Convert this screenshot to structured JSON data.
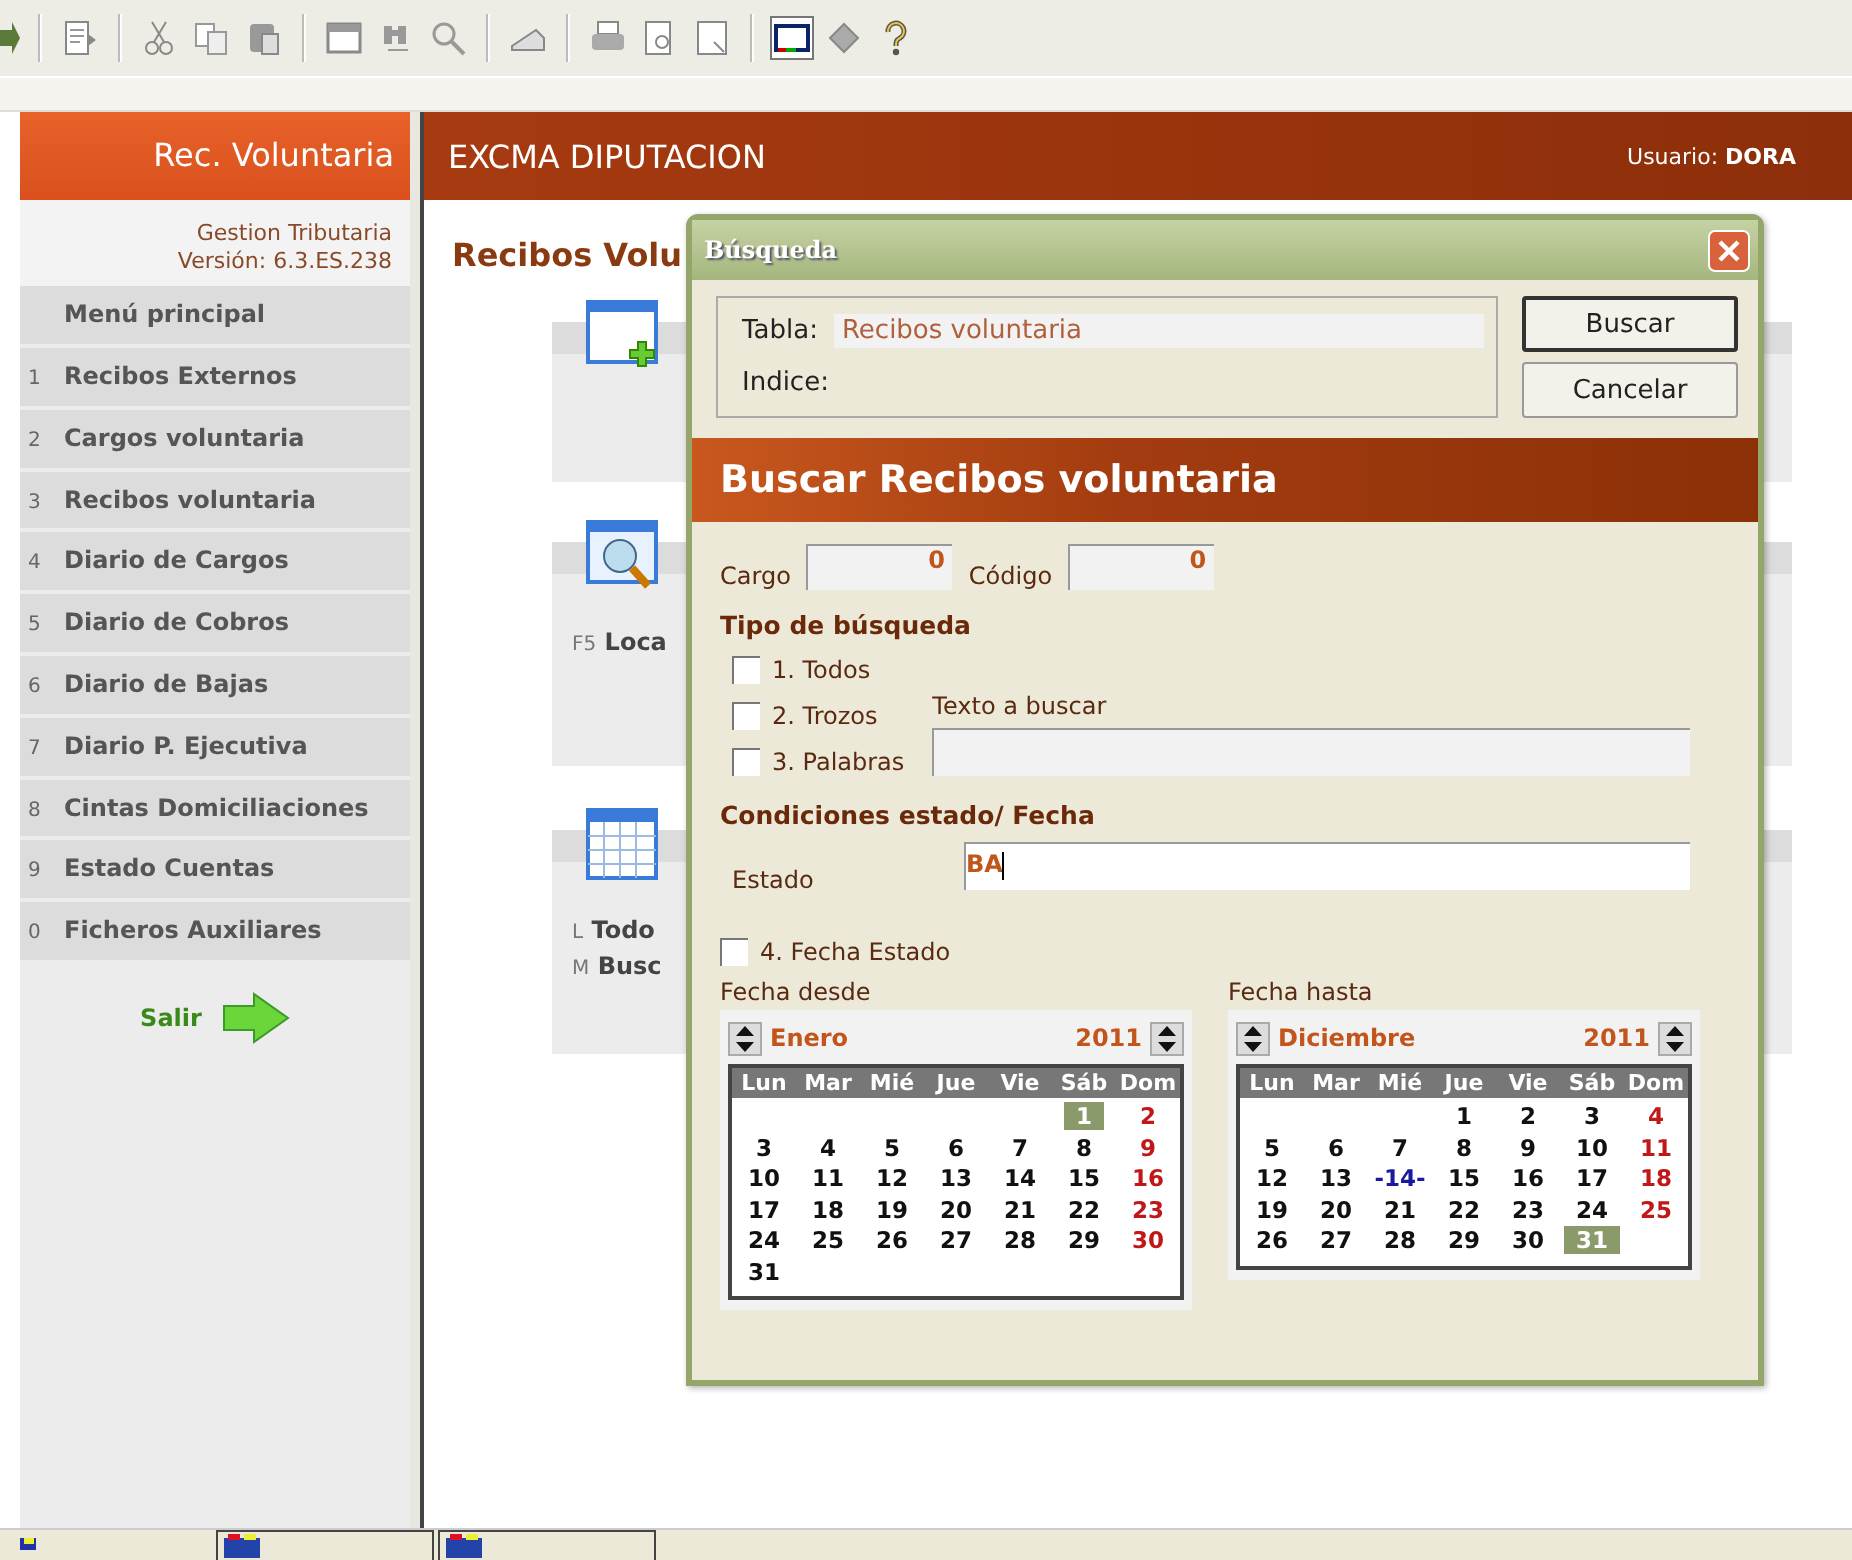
{
  "sidebar": {
    "title": "Rec. Voluntaria",
    "app_name": "Gestion Tributaria",
    "version": "Versión: 6.3.ES.238",
    "menu_heading": "Menú principal",
    "items": [
      {
        "key": "1",
        "label": "Recibos Externos"
      },
      {
        "key": "2",
        "label": "Cargos voluntaria"
      },
      {
        "key": "3",
        "label": "Recibos voluntaria"
      },
      {
        "key": "4",
        "label": "Diario de Cargos"
      },
      {
        "key": "5",
        "label": "Diario de Cobros"
      },
      {
        "key": "6",
        "label": "Diario de Bajas"
      },
      {
        "key": "7",
        "label": "Diario P. Ejecutiva"
      },
      {
        "key": "8",
        "label": "Cintas Domiciliaciones"
      },
      {
        "key": "9",
        "label": "Estado Cuentas"
      },
      {
        "key": "0",
        "label": "Ficheros Auxiliares"
      }
    ],
    "exit_label": "Salir"
  },
  "header": {
    "title": "EXCMA DIPUTACION",
    "user_label": "Usuario:",
    "user": "DORA"
  },
  "main": {
    "title": "Recibos Volu",
    "cards": [
      {
        "lines": [
          {
            "key": "F5",
            "label": "Loca"
          }
        ]
      },
      {
        "lines": [
          {
            "key": "L",
            "label": "Todo"
          },
          {
            "key": "M",
            "label": "Busc"
          }
        ]
      }
    ]
  },
  "dialog": {
    "title": "Búsqueda",
    "table_label": "Tabla:",
    "table_value": "Recibos voluntaria",
    "index_label": "Indice:",
    "buttons": [
      {
        "label": "Buscar",
        "default": true
      },
      {
        "label": "Cancelar",
        "default": false
      }
    ],
    "banner": "Buscar Recibos voluntaria",
    "cargo_label": "Cargo",
    "cargo_value": "0",
    "codigo_label": "Código",
    "codigo_value": "0",
    "search_type_heading": "Tipo de búsqueda",
    "search_types": [
      {
        "label": "1. Todos",
        "checked": false
      },
      {
        "label": "2. Trozos",
        "checked": false
      },
      {
        "label": "3. Palabras",
        "checked": false
      }
    ],
    "search_text_label": "Texto a buscar",
    "conditions_heading": "Condiciones estado/ Fecha",
    "estado_label": "Estado",
    "estado_value": "BA",
    "date_state": {
      "label": "4. Fecha Estado",
      "checked": false
    },
    "calendars": [
      {
        "label": "Fecha desde",
        "month": "Enero",
        "year": "2011",
        "weekdays": [
          "Lun",
          "Mar",
          "Mié",
          "Jue",
          "Vie",
          "Sáb",
          "Dom"
        ],
        "weeks": [
          [
            {
              "kind": "blank"
            },
            {
              "kind": "blank"
            },
            {
              "kind": "blank"
            },
            {
              "kind": "blank"
            },
            {
              "kind": "blank"
            },
            {
              "day": "1",
              "kind": "day",
              "selected": true
            },
            {
              "day": "2",
              "kind": "sunday",
              "selected": false
            }
          ],
          [
            {
              "day": "3",
              "kind": "day",
              "selected": false
            },
            {
              "day": "4",
              "kind": "day",
              "selected": false
            },
            {
              "day": "5",
              "kind": "day",
              "selected": false
            },
            {
              "day": "6",
              "kind": "day",
              "selected": false
            },
            {
              "day": "7",
              "kind": "day",
              "selected": false
            },
            {
              "day": "8",
              "kind": "day",
              "selected": false
            },
            {
              "day": "9",
              "kind": "sunday",
              "selected": false
            }
          ],
          [
            {
              "day": "10",
              "kind": "day",
              "selected": false
            },
            {
              "day": "11",
              "kind": "day",
              "selected": false
            },
            {
              "day": "12",
              "kind": "day",
              "selected": false
            },
            {
              "day": "13",
              "kind": "day",
              "selected": false
            },
            {
              "day": "14",
              "kind": "day",
              "selected": false
            },
            {
              "day": "15",
              "kind": "day",
              "selected": false
            },
            {
              "day": "16",
              "kind": "sunday",
              "selected": false
            }
          ],
          [
            {
              "day": "17",
              "kind": "day",
              "selected": false
            },
            {
              "day": "18",
              "kind": "day",
              "selected": false
            },
            {
              "day": "19",
              "kind": "day",
              "selected": false
            },
            {
              "day": "20",
              "kind": "day",
              "selected": false
            },
            {
              "day": "21",
              "kind": "day",
              "selected": false
            },
            {
              "day": "22",
              "kind": "day",
              "selected": false
            },
            {
              "day": "23",
              "kind": "sunday",
              "selected": false
            }
          ],
          [
            {
              "day": "24",
              "kind": "day",
              "selected": false
            },
            {
              "day": "25",
              "kind": "day",
              "selected": false
            },
            {
              "day": "26",
              "kind": "day",
              "selected": false
            },
            {
              "day": "27",
              "kind": "day",
              "selected": false
            },
            {
              "day": "28",
              "kind": "day",
              "selected": false
            },
            {
              "day": "29",
              "kind": "day",
              "selected": false
            },
            {
              "day": "30",
              "kind": "sunday",
              "selected": false
            }
          ],
          [
            {
              "day": "31",
              "kind": "day",
              "selected": false
            }
          ]
        ]
      },
      {
        "label": "Fecha hasta",
        "month": "Diciembre",
        "year": "2011",
        "weekdays": [
          "Lun",
          "Mar",
          "Mié",
          "Jue",
          "Vie",
          "Sáb",
          "Dom"
        ],
        "weeks": [
          [
            {
              "kind": "blank"
            },
            {
              "kind": "blank"
            },
            {
              "kind": "blank"
            },
            {
              "day": "1",
              "kind": "day",
              "selected": false
            },
            {
              "day": "2",
              "kind": "day",
              "selected": false
            },
            {
              "day": "3",
              "kind": "day",
              "selected": false
            },
            {
              "day": "4",
              "kind": "sunday",
              "selected": false
            }
          ],
          [
            {
              "day": "5",
              "kind": "day",
              "selected": false
            },
            {
              "day": "6",
              "kind": "day",
              "selected": false
            },
            {
              "day": "7",
              "kind": "day",
              "selected": false
            },
            {
              "day": "8",
              "kind": "day",
              "selected": false
            },
            {
              "day": "9",
              "kind": "day",
              "selected": false
            },
            {
              "day": "10",
              "kind": "day",
              "selected": false
            },
            {
              "day": "11",
              "kind": "sunday",
              "selected": false
            }
          ],
          [
            {
              "day": "12",
              "kind": "day",
              "selected": false
            },
            {
              "day": "13",
              "kind": "day",
              "selected": false
            },
            {
              "day": "-14-",
              "kind": "today",
              "selected": false
            },
            {
              "day": "15",
              "kind": "day",
              "selected": false
            },
            {
              "day": "16",
              "kind": "day",
              "selected": false
            },
            {
              "day": "17",
              "kind": "day",
              "selected": false
            },
            {
              "day": "18",
              "kind": "sunday",
              "selected": false
            }
          ],
          [
            {
              "day": "19",
              "kind": "day",
              "selected": false
            },
            {
              "day": "20",
              "kind": "day",
              "selected": false
            },
            {
              "day": "21",
              "kind": "day",
              "selected": false
            },
            {
              "day": "22",
              "kind": "day",
              "selected": false
            },
            {
              "day": "23",
              "kind": "day",
              "selected": false
            },
            {
              "day": "24",
              "kind": "day",
              "selected": false
            },
            {
              "day": "25",
              "kind": "sunday",
              "selected": false
            }
          ],
          [
            {
              "day": "26",
              "kind": "day",
              "selected": false
            },
            {
              "day": "27",
              "kind": "day",
              "selected": false
            },
            {
              "day": "28",
              "kind": "day",
              "selected": false
            },
            {
              "day": "29",
              "kind": "day",
              "selected": false
            },
            {
              "day": "30",
              "kind": "day",
              "selected": false
            },
            {
              "day": "31",
              "kind": "day",
              "selected": true
            }
          ]
        ]
      }
    ]
  }
}
